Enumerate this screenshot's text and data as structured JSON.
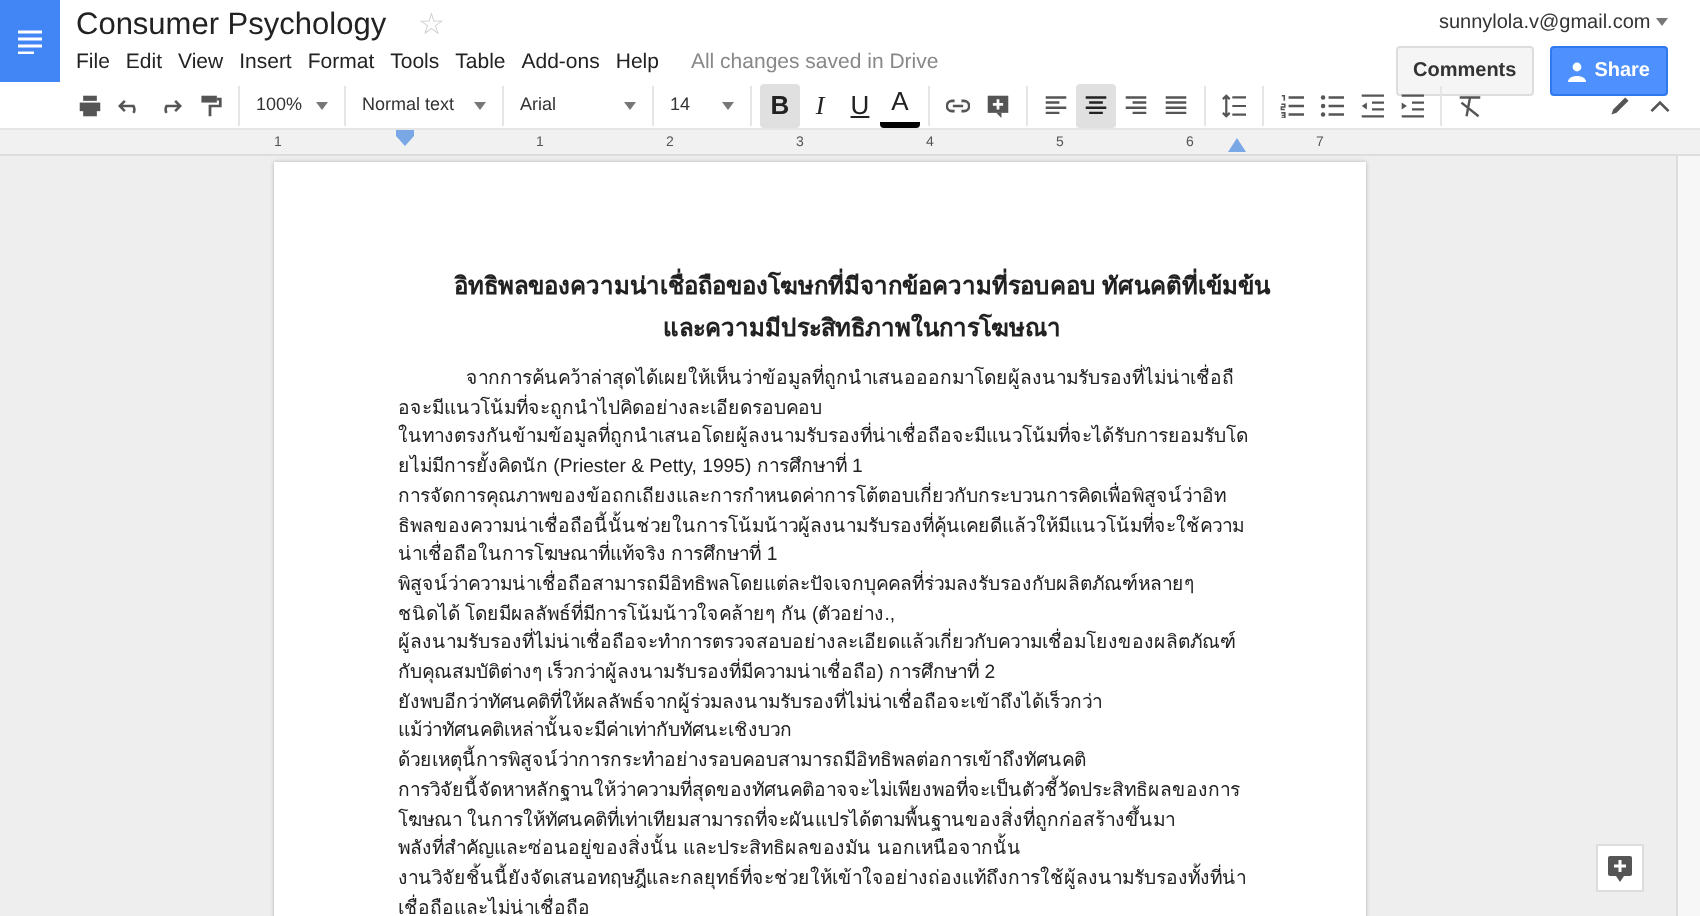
{
  "header": {
    "title": "Consumer Psychology",
    "starred": false,
    "star": "☆",
    "account": "sunnylola.v@gmail.com",
    "status": "All changes saved in Drive",
    "comments_button": "Comments",
    "share_button": "Share"
  },
  "menu": [
    "File",
    "Edit",
    "View",
    "Insert",
    "Format",
    "Tools",
    "Table",
    "Add-ons",
    "Help"
  ],
  "toolbar": {
    "zoom": "100%",
    "style": "Normal text",
    "font": "Arial",
    "size": "14",
    "format_buttons": [
      {
        "label": "B",
        "selected": true
      },
      {
        "label": "I",
        "selected": false
      },
      {
        "label": "U",
        "selected": false
      },
      {
        "label": "A",
        "selected": false
      }
    ],
    "align_buttons": [
      {
        "selected": false
      },
      {
        "selected": true
      },
      {
        "selected": false
      },
      {
        "selected": false
      }
    ]
  },
  "ruler": [
    "1",
    "1",
    "2",
    "3",
    "4",
    "5",
    "6",
    "7"
  ],
  "document": {
    "title_lines": [
      "อิทธิพลของความน่าเชื่อถือของโฆษกที่มีจากข้อความที่รอบคอบ ทัศนคติที่เข้มข้น",
      "และความมีประสิทธิภาพในการโฆษณา"
    ],
    "body_lines": [
      {
        "text": "จากการค้นคว้าล่าสุดได้เผยให้เห็นว่าข้อมูลที่ถูกนำเสนอออกมาโดยผู้ลงนามรับรองที่ไม่น่าเชื่อถื",
        "indent": true
      },
      {
        "text": "อจะมีแนวโน้มที่จะถูกนำไปคิดอย่างละเอียดรอบคอบ",
        "indent": false
      },
      {
        "text": "ในทางตรงกันข้ามข้อมูลที่ถูกนำเสนอโดยผู้ลงนามรับรองที่น่าเชื่อถือจะมีแนวโน้มที่จะได้รับการยอมรับโด",
        "indent": false
      },
      {
        "text": "ยไม่มีการยั้งคิดนัก (Priester & Petty, 1995) การศึกษาที่ 1",
        "indent": false
      },
      {
        "text": "การจัดการคุณภาพของข้อถกเถียงและการกำหนดค่าการโต้ตอบเกี่ยวกับกระบวนการคิดเพื่อพิสูจน์ว่าอิท",
        "indent": false
      },
      {
        "text": "ธิพลของความน่าเชื่อถือนี้นั้นช่วยในการโน้มน้าวผู้ลงนามรับรองที่คุ้นเคยดีแล้วให้มีแนวโน้มที่จะใช้ความ",
        "indent": false
      },
      {
        "text": "น่าเชื่อถือในการโฆษณาที่แท้จริง การศึกษาที่ 1",
        "indent": false
      },
      {
        "text": "พิสูจน์ว่าความน่าเชื่อถือสามารถมีอิทธิพลโดยแต่ละปัจเจกบุคคลที่ร่วมลงรับรองกับผลิตภัณฑ์หลายๆ",
        "indent": false
      },
      {
        "text": "ชนิดได้ โดยมีผลลัพธ์ที่มีการโน้มน้าวใจคล้ายๆ กัน (ตัวอย่าง.,",
        "indent": false
      },
      {
        "text": "ผู้ลงนามรับรองที่ไม่น่าเชื่อถือจะทำการตรวจสอบอย่างละเอียดแล้วเกี่ยวกับความเชื่อมโยงของผลิตภัณฑ์",
        "indent": false
      },
      {
        "text": "กับคุณสมบัติต่างๆ เร็วกว่าผู้ลงนามรับรองที่มีความน่าเชื่อถือ) การศึกษาที่ 2",
        "indent": false
      },
      {
        "text": "ยังพบอีกว่าทัศนคติที่ให้ผลลัพธ์จากผู้ร่วมลงนามรับรองที่ไม่น่าเชื่อถือจะเข้าถึงได้เร็วกว่า",
        "indent": false
      },
      {
        "text": "แม้ว่าทัศนคติเหล่านั้นจะมีค่าเท่ากับทัศนะเชิงบวก",
        "indent": false
      },
      {
        "text": "ด้วยเหตุนี้การพิสูจน์ว่าการกระทำอย่างรอบคอบสามารถมีอิทธิพลต่อการเข้าถึงทัศนคติ",
        "indent": false
      },
      {
        "text": "การวิจัยนี้จัดหาหลักฐานให้ว่าความที่สุดของทัศนคติอาจจะไม่เพียงพอที่จะเป็นตัวชี้วัดประสิทธิผลของการ",
        "indent": false
      },
      {
        "text": "โฆษณา ในการให้ทัศนคติที่เท่าเทียมสามารถที่จะผันแปรได้ตามพื้นฐานของสิ่งที่ถูกก่อสร้างขึ้นมา",
        "indent": false
      },
      {
        "text": "พลังที่สำคัญและซ่อนอยู่ของสิ่งนั้น และประสิทธิผลของมัน นอกเหนือจากนั้น",
        "indent": false
      },
      {
        "text": "งานวิจัยชิ้นนี้ยังจัดเสนอทฤษฎีและกลยุทธ์ที่จะช่วยให้เข้าใจอย่างถ่องแท้ถึงการใช้ผู้ลงนามรับรองทั้งที่น่า",
        "indent": false
      },
      {
        "text": "เชื่อถือและไม่น่าเชื่อถือ",
        "indent": false
      }
    ]
  }
}
